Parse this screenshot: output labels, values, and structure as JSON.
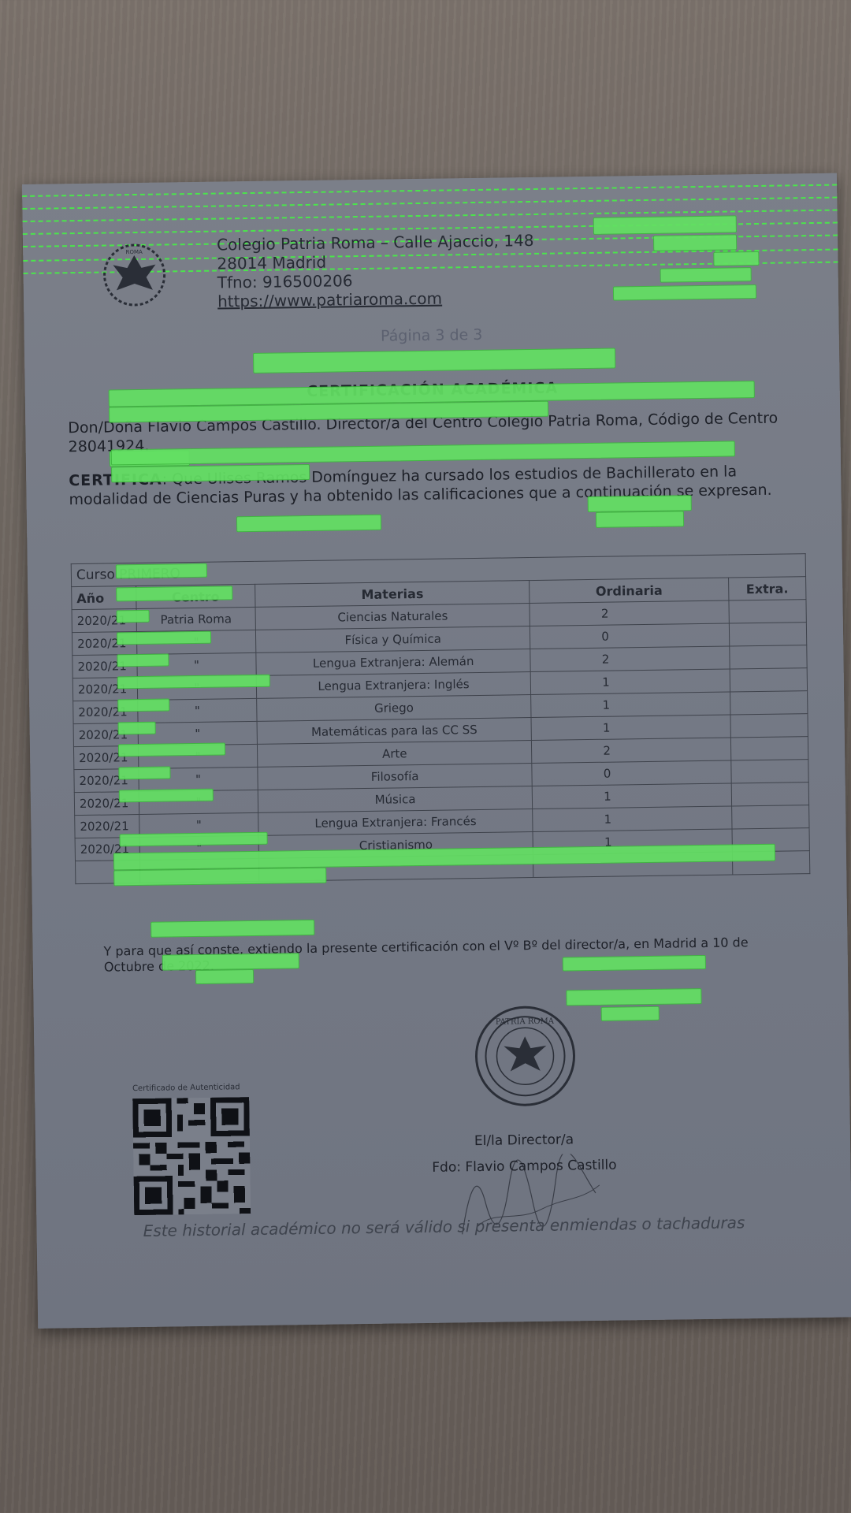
{
  "header": {
    "school_line": "Colegio Patria Roma – Calle Ajaccio, 148",
    "city_line": "28014 Madrid",
    "phone_line": "Tfno: 916500206",
    "url": "https://www.patriaroma.com"
  },
  "page_number": "Página 3 de 3",
  "title": "CERTIFICACIÓN ACADÉMICA",
  "intro": "Don/Doña Flavio Campos Castillo. Director/a del Centro Colegio Patria Roma, Código de Centro 28041924.",
  "certifica_label": "CERTIFICA",
  "certifica_text": ": Que Ulises Ramos Domínguez ha cursado los estudios de Bachillerato en la modalidad de Ciencias Puras y ha obtenido las calificaciones que a continuación se expresan.",
  "table": {
    "course_label": "Curso PRIMERO",
    "headers": [
      "Año",
      "Centro",
      "Materias",
      "Ordinaria",
      "Extra."
    ],
    "rows": [
      {
        "year": "2020/21",
        "centro": "Patria Roma",
        "materia": "Ciencias Naturales",
        "ordinaria": "2",
        "extra": ""
      },
      {
        "year": "2020/21",
        "centro": "\"",
        "materia": "Física y Química",
        "ordinaria": "0",
        "extra": ""
      },
      {
        "year": "2020/21",
        "centro": "\"",
        "materia": "Lengua Extranjera: Alemán",
        "ordinaria": "2",
        "extra": ""
      },
      {
        "year": "2020/21",
        "centro": "\"",
        "materia": "Lengua Extranjera: Inglés",
        "ordinaria": "1",
        "extra": ""
      },
      {
        "year": "2020/21",
        "centro": "\"",
        "materia": "Griego",
        "ordinaria": "1",
        "extra": ""
      },
      {
        "year": "2020/21",
        "centro": "\"",
        "materia": "Matemáticas para las CC SS",
        "ordinaria": "1",
        "extra": ""
      },
      {
        "year": "2020/21",
        "centro": "\"",
        "materia": "Arte",
        "ordinaria": "2",
        "extra": ""
      },
      {
        "year": "2020/21",
        "centro": "\"",
        "materia": "Filosofía",
        "ordinaria": "0",
        "extra": ""
      },
      {
        "year": "2020/21",
        "centro": "\"",
        "materia": "Música",
        "ordinaria": "1",
        "extra": ""
      },
      {
        "year": "2020/21",
        "centro": "\"",
        "materia": "Lengua Extranjera: Francés",
        "ordinaria": "1",
        "extra": ""
      },
      {
        "year": "2020/21",
        "centro": "\"",
        "materia": "Cristianismo",
        "ordinaria": "1",
        "extra": ""
      }
    ]
  },
  "closing": "Y para que así conste, extiendo la presente certificación con el Vº Bº del director/a, en Madrid a 10 de Octubre de 2022.",
  "seal_text": "PATRIA ROMA",
  "logo_text": "ROMA",
  "qr_caption": "Certificado de Autenticidad",
  "director_label": "El/la Director/a",
  "signature_line": "Fdo: Flavio Campos Castillo",
  "footer": "Este historial académico no será válido si presenta enmiendas o tachaduras",
  "colors": {
    "highlight": "#63e063",
    "paper": "#767b87",
    "wood": "#6f6761"
  }
}
